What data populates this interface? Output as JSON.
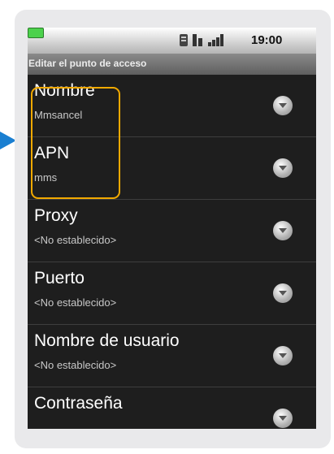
{
  "status_bar": {
    "time": "19:00"
  },
  "title_bar": {
    "title": "Editar el punto de acceso"
  },
  "items": [
    {
      "title": "Nombre",
      "summary": "Mmsancel"
    },
    {
      "title": "APN",
      "summary": "mms"
    },
    {
      "title": "Proxy",
      "summary": "<No establecido>"
    },
    {
      "title": "Puerto",
      "summary": "<No establecido>"
    },
    {
      "title": "Nombre de usuario",
      "summary": "<No establecido>"
    },
    {
      "title": "Contraseña",
      "summary": ""
    }
  ],
  "colors": {
    "highlight": "#f2a900",
    "pointer_arrow": "#1a7fd1",
    "battery": "#4cd14c"
  },
  "icons": [
    "sim-icon",
    "data-icon",
    "signal-icon",
    "battery-icon",
    "chevron-down-icon"
  ]
}
